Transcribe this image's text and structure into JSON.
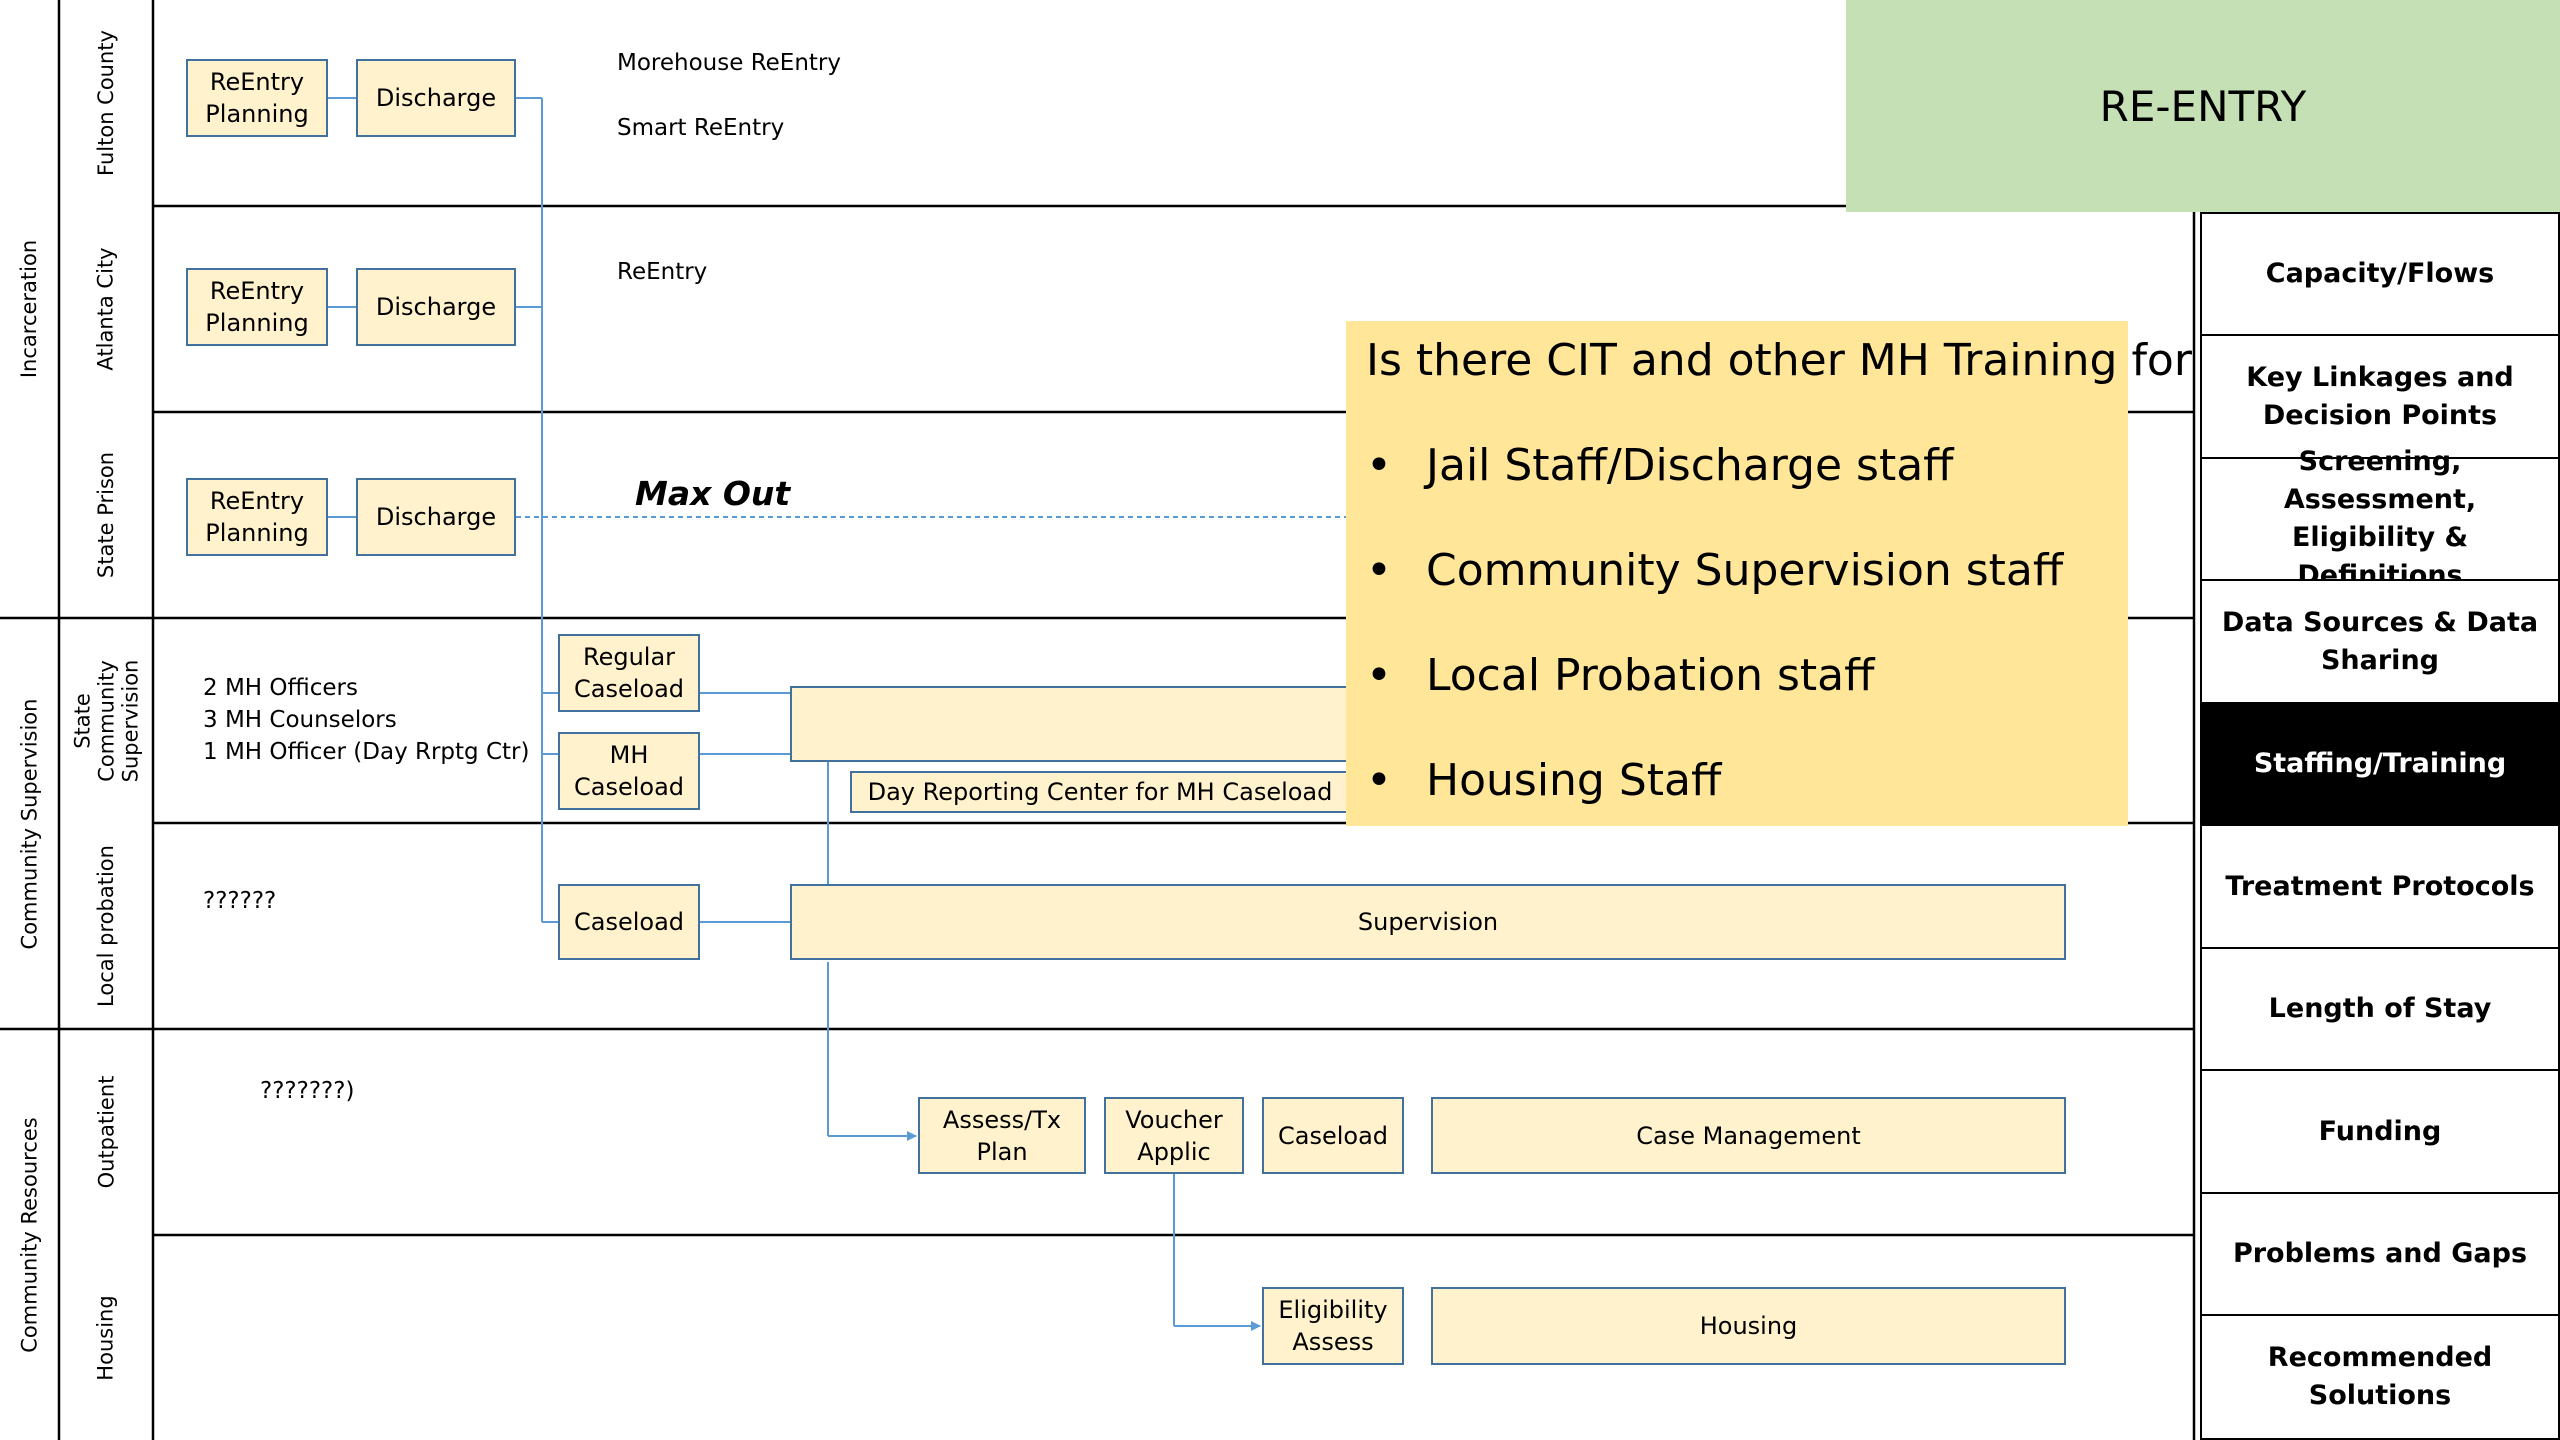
{
  "header": {
    "title": "RE-ENTRY"
  },
  "groups": [
    {
      "label": "Incarceration"
    },
    {
      "label": "Community Supervision"
    },
    {
      "label": "Community Resources"
    }
  ],
  "lanes": [
    {
      "label": "Fulton County"
    },
    {
      "label": "Atlanta City"
    },
    {
      "label": "State Prison"
    },
    {
      "label": "State Community Supervision"
    },
    {
      "label": "Local probation"
    },
    {
      "label": "Outpatient"
    },
    {
      "label": "Housing"
    }
  ],
  "boxes": {
    "fulton_planning": "ReEntry Planning",
    "fulton_discharge": "Discharge",
    "atlanta_planning": "ReEntry Planning",
    "atlanta_discharge": "Discharge",
    "prison_planning": "ReEntry Planning",
    "prison_discharge": "Discharge",
    "regular_caseload": "Regular Caseload",
    "mh_caseload": "MH Caseload",
    "supervision_bar": "",
    "day_reporting": "Day Reporting Center for MH Caseload",
    "local_caseload": "Caseload",
    "local_supervision": "Supervision",
    "assess_tx_plan": "Assess/Tx Plan",
    "voucher_applic": "Voucher Applic",
    "outpatient_caseload": "Caseload",
    "case_management": "Case Management",
    "eligibility_assess": "Eligibility Assess",
    "housing": "Housing"
  },
  "notes": {
    "morehouse": "Morehouse ReEntry",
    "smart": "Smart ReEntry",
    "reentry": "ReEntry",
    "max_out": "Max Out",
    "mh_officers": "2 MH Officers",
    "mh_counselors": "3 MH Counselors",
    "mh_officer_day": "1 MH Officer (Day Rrptg Ctr)",
    "local_unknown": "??????",
    "outpatient_unknown": "???????)"
  },
  "callout": {
    "title": "Is there CIT and other MH Training for",
    "items": [
      "Jail Staff/Discharge staff",
      "Community Supervision staff",
      "Local Probation staff",
      "Housing Staff"
    ]
  },
  "sidebar": {
    "items": [
      {
        "label": "Capacity/Flows",
        "active": false
      },
      {
        "label": "Key Linkages and Decision Points",
        "active": false
      },
      {
        "label": "Screening, Assessment, Eligibility & Definitions",
        "active": false
      },
      {
        "label": "Data Sources & Data Sharing",
        "active": false
      },
      {
        "label": "Staffing/Training",
        "active": true
      },
      {
        "label": "Treatment Protocols",
        "active": false
      },
      {
        "label": "Length of Stay",
        "active": false
      },
      {
        "label": "Funding",
        "active": false
      },
      {
        "label": "Problems and Gaps",
        "active": false
      },
      {
        "label": "Recommended Solutions",
        "active": false
      }
    ]
  },
  "colors": {
    "box_fill": "#fff2cc",
    "box_border": "#41719c",
    "connector": "#5b9bd5",
    "header_fill": "#c5e0b4",
    "callout_fill": "#ffe699",
    "active_tab": "#000000"
  }
}
